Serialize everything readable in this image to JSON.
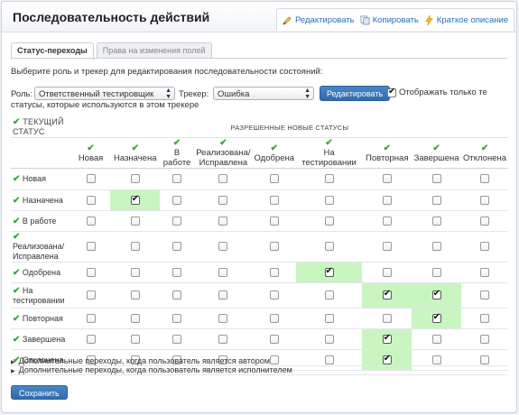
{
  "header": {
    "title": "Последовательность действий",
    "actions": [
      {
        "label": "Редактировать",
        "icon": "pencil-icon"
      },
      {
        "label": "Копировать",
        "icon": "copy-icon"
      },
      {
        "label": "Краткое описание",
        "icon": "lightning-icon"
      }
    ]
  },
  "tabs": [
    {
      "label": "Статус-переходы",
      "active": true
    },
    {
      "label": "Права на изменения полей",
      "active": false
    }
  ],
  "instruction": "Выберите роль и трекер для редактирования последовательности состояний:",
  "filters": {
    "role_label": "Роль:",
    "role_value": "Ответственный тестировщик",
    "tracker_label": "Трекер:",
    "tracker_value": "Ошибка",
    "edit_button": "Редактировать",
    "only_used_line1": "Отображать только те",
    "only_used_line2": "статусы, которые используются в этом трекере",
    "only_used_checked": true
  },
  "grid": {
    "current_status_header": "ТЕКУЩИЙ СТАТУС",
    "new_statuses_header": "РАЗРЕШЕННЫЕ НОВЫЕ СТАТУСЫ",
    "columns": [
      "Новая",
      "Назначена",
      "В работе",
      "Реализована/ Исправлена",
      "Одобрена",
      "На тестировании",
      "Повторная",
      "Завершена",
      "Отклонена"
    ],
    "rows": [
      {
        "name": "Новая",
        "checked": [
          0,
          0,
          0,
          0,
          0,
          0,
          0,
          0,
          0
        ]
      },
      {
        "name": "Назначена",
        "checked": [
          0,
          1,
          0,
          0,
          0,
          0,
          0,
          0,
          0
        ]
      },
      {
        "name": "В работе",
        "checked": [
          0,
          0,
          0,
          0,
          0,
          0,
          0,
          0,
          0
        ]
      },
      {
        "name": "Реализована/ Исправлена",
        "checked": [
          0,
          0,
          0,
          0,
          0,
          0,
          0,
          0,
          0
        ]
      },
      {
        "name": "Одобрена",
        "checked": [
          0,
          0,
          0,
          0,
          0,
          1,
          0,
          0,
          0
        ]
      },
      {
        "name": "На тестировании",
        "checked": [
          0,
          0,
          0,
          0,
          0,
          0,
          1,
          1,
          0
        ]
      },
      {
        "name": "Повторная",
        "checked": [
          0,
          0,
          0,
          0,
          0,
          0,
          0,
          1,
          0
        ]
      },
      {
        "name": "Завершена",
        "checked": [
          0,
          0,
          0,
          0,
          0,
          0,
          1,
          0,
          0
        ]
      },
      {
        "name": "Отклонена",
        "checked": [
          0,
          0,
          0,
          0,
          0,
          0,
          1,
          0,
          0
        ]
      }
    ]
  },
  "extra": [
    "Дополнительные переходы, когда пользователь является автором",
    "Дополнительные переходы, когда пользователь является исполнителем"
  ],
  "save_button": "Сохранить",
  "colors": {
    "accent": "#2f6aac",
    "highlight": "#c9f5c0",
    "tick": "#3ea33e",
    "link": "#2a6fb6"
  }
}
